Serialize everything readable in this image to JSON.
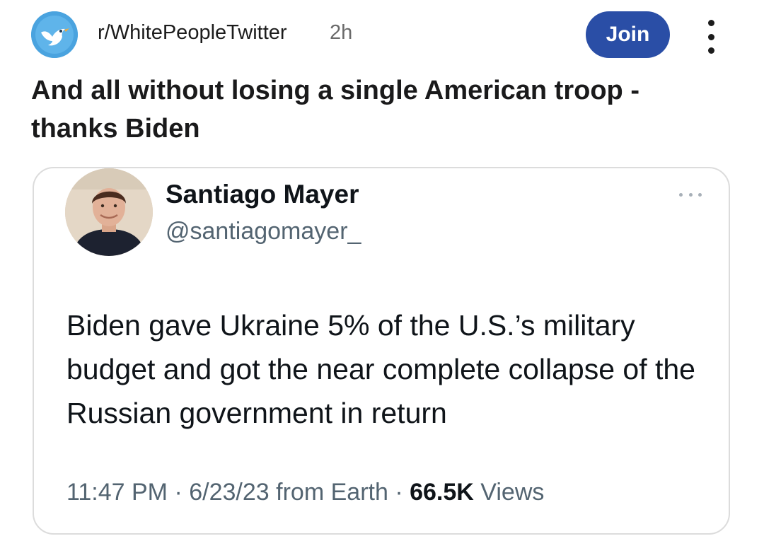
{
  "post": {
    "subreddit": "r/WhitePeopleTwitter",
    "age": "2h",
    "join_label": "Join",
    "title": "And all without losing a single American troop - thanks Biden"
  },
  "tweet": {
    "author_name": "Santiago Mayer",
    "author_handle": "@santiagomayer_",
    "text": "Biden gave Ukraine 5% of the U.S.’s military budget and got the near complete collapse of the Russian government in return",
    "time": "11:47 PM",
    "separator": "·",
    "date": "6/23/23",
    "source": "from Earth",
    "views_count": "66.5K",
    "views_label": "Views"
  },
  "icons": {
    "subreddit_avatar": "bird-icon",
    "post_menu": "more-vertical-icon",
    "tweet_menu": "more-horizontal-icon"
  },
  "colors": {
    "join_button": "#2a4ea6",
    "subreddit_avatar_bg": "#4aa3df",
    "secondary_text": "#536471",
    "card_border": "#dcdcdc"
  }
}
